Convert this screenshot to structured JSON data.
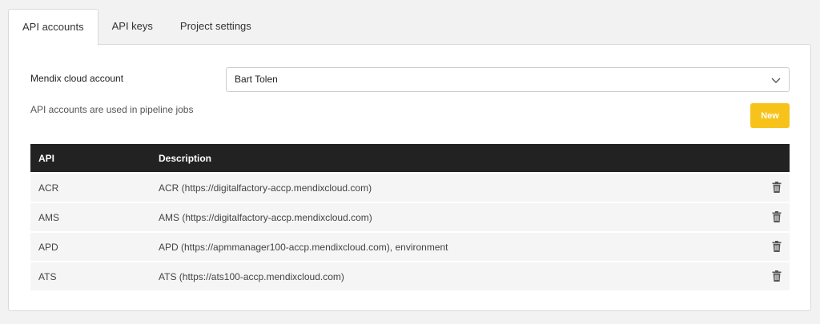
{
  "tabs": [
    {
      "label": "API accounts",
      "active": true
    },
    {
      "label": "API keys",
      "active": false
    },
    {
      "label": "Project settings",
      "active": false
    }
  ],
  "account": {
    "label": "Mendix cloud account",
    "selected": "Bart Tolen"
  },
  "hint": "API accounts are used in pipeline jobs",
  "new_button": "New",
  "table": {
    "headers": [
      "API",
      "Description"
    ],
    "rows": [
      {
        "api": "ACR",
        "description": "ACR (https://digitalfactory-accp.mendixcloud.com)"
      },
      {
        "api": "AMS",
        "description": "AMS (https://digitalfactory-accp.mendixcloud.com)"
      },
      {
        "api": "APD",
        "description": "APD (https://apmmanager100-accp.mendixcloud.com), environment"
      },
      {
        "api": "ATS",
        "description": "ATS (https://ats100-accp.mendixcloud.com)"
      }
    ]
  },
  "colors": {
    "accent": "#f7c31b",
    "header_bg": "#222222"
  },
  "icons": {
    "dropdown": "chevron-down-icon",
    "delete": "trash-icon"
  }
}
